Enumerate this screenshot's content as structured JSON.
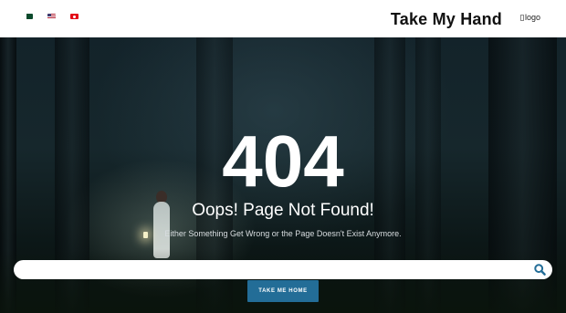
{
  "header": {
    "languages": [
      {
        "code": "ur",
        "icon": "pakistan-flag-icon"
      },
      {
        "code": "en",
        "icon": "us-flag-icon"
      },
      {
        "code": "tr",
        "icon": "turkey-flag-icon"
      }
    ],
    "brand_name": "Take My Hand",
    "logo_alt": "logo"
  },
  "error": {
    "code": "404",
    "title": "Oops! Page Not Found!",
    "subtitle": "Either Something Get Wrong or the Page Doesn't Exist Anymore."
  },
  "search": {
    "value": "",
    "placeholder": "",
    "icon": "search-icon"
  },
  "home_button": {
    "label": "TAKE ME HOME"
  },
  "colors": {
    "accent": "#236d97",
    "search_icon": "#236d97",
    "header_bg": "#ffffff"
  }
}
